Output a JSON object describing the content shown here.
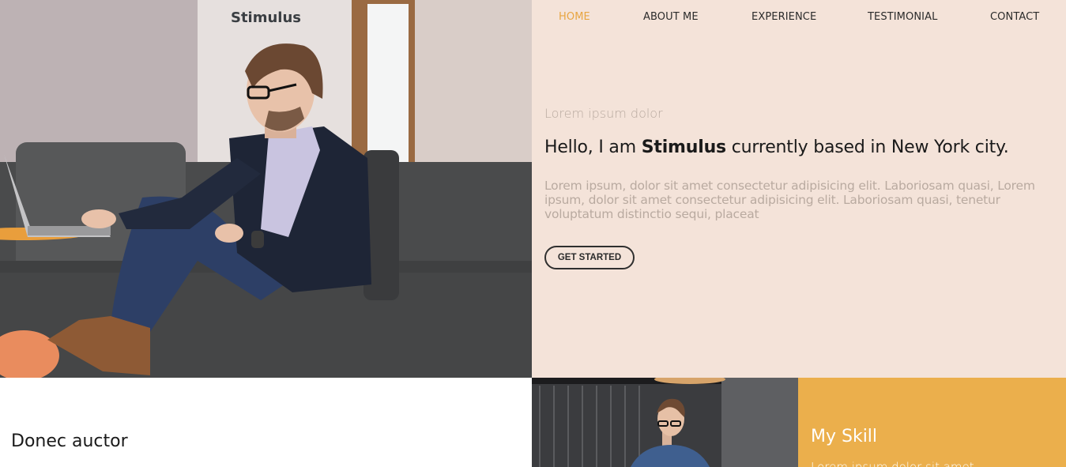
{
  "brand": {
    "name": "Stimulus"
  },
  "nav": {
    "items": [
      {
        "label": "HOME",
        "active": true
      },
      {
        "label": "ABOUT ME",
        "active": false
      },
      {
        "label": "EXPERIENCE",
        "active": false
      },
      {
        "label": "TESTIMONIAL",
        "active": false
      },
      {
        "label": "CONTACT",
        "active": false
      }
    ]
  },
  "hero": {
    "kicker": "Lorem ipsum dolor",
    "headline_prefix": "Hello, I am ",
    "headline_name": "Stimulus",
    "headline_suffix": " currently based in New York city.",
    "intro": "Lorem ipsum, dolor sit amet consectetur adipisicing elit. Laboriosam quasi, Lorem ipsum, dolor sit amet consectetur adipisicing elit. Laboriosam quasi, tenetur voluptatum distinctio sequi, placeat",
    "cta_label": "GET STARTED"
  },
  "about": {
    "title": "Donec auctor"
  },
  "skills": {
    "title": "My Skill",
    "text": "Lorem ipsum dolor sit amet"
  },
  "colors": {
    "accent": "#e8a541",
    "panel_bg": "#f4e3d9",
    "skill_bg": "#ebaf4c",
    "muted_text": "#b9aaa0"
  }
}
